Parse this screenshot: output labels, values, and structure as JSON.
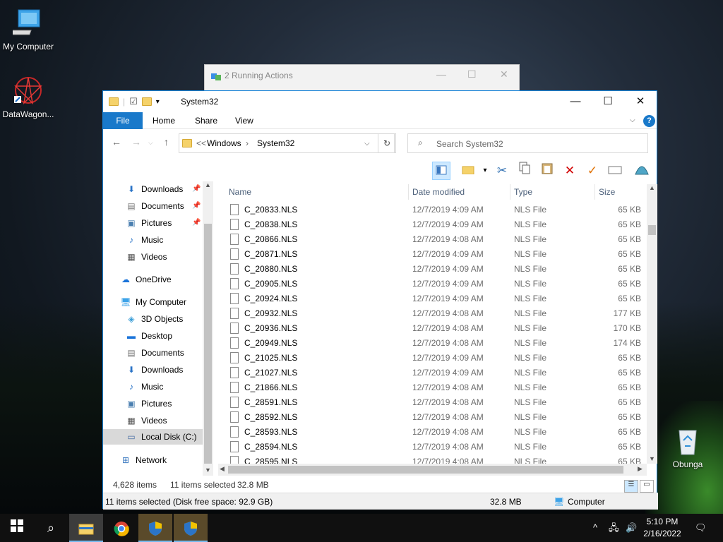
{
  "desktop": {
    "icons": [
      {
        "label": "My Computer"
      },
      {
        "label": "DataWagon..."
      },
      {
        "label": "Obunga"
      }
    ]
  },
  "back_dialog": {
    "title": "2 Running Actions"
  },
  "window": {
    "title": "System32",
    "tabs": [
      "File",
      "Home",
      "Share",
      "View"
    ],
    "address": {
      "prefix": "<<",
      "parts": [
        "Windows",
        "System32"
      ],
      "separator": "›"
    },
    "search_placeholder": "Search System32",
    "nav": [
      {
        "label": "Downloads",
        "icon": "download-icon",
        "pinned": true
      },
      {
        "label": "Documents",
        "icon": "documents-icon",
        "pinned": true
      },
      {
        "label": "Pictures",
        "icon": "pictures-icon",
        "pinned": true
      },
      {
        "label": "Music",
        "icon": "music-icon",
        "pinned": false
      },
      {
        "label": "Videos",
        "icon": "videos-icon",
        "pinned": false
      },
      {
        "label": "OneDrive",
        "icon": "onedrive-icon",
        "pinned": false
      },
      {
        "label": "My Computer",
        "icon": "computer-icon",
        "pinned": false
      },
      {
        "label": "3D Objects",
        "icon": "3d-objects-icon",
        "pinned": false
      },
      {
        "label": "Desktop",
        "icon": "desktop-icon",
        "pinned": false
      },
      {
        "label": "Documents",
        "icon": "documents-icon",
        "pinned": false
      },
      {
        "label": "Downloads",
        "icon": "download-icon",
        "pinned": false
      },
      {
        "label": "Music",
        "icon": "music-icon",
        "pinned": false
      },
      {
        "label": "Pictures",
        "icon": "pictures-icon",
        "pinned": false
      },
      {
        "label": "Videos",
        "icon": "videos-icon",
        "pinned": false
      },
      {
        "label": "Local Disk (C:)",
        "icon": "disk-icon",
        "pinned": false,
        "selected": true
      },
      {
        "label": "Network",
        "icon": "network-icon",
        "pinned": false
      }
    ],
    "columns": [
      "Name",
      "Date modified",
      "Type",
      "Size"
    ],
    "files": [
      {
        "name": "C_20833.NLS",
        "date": "12/7/2019 4:09 AM",
        "type": "NLS File",
        "size": "65 KB"
      },
      {
        "name": "C_20838.NLS",
        "date": "12/7/2019 4:09 AM",
        "type": "NLS File",
        "size": "65 KB"
      },
      {
        "name": "C_20866.NLS",
        "date": "12/7/2019 4:08 AM",
        "type": "NLS File",
        "size": "65 KB"
      },
      {
        "name": "C_20871.NLS",
        "date": "12/7/2019 4:09 AM",
        "type": "NLS File",
        "size": "65 KB"
      },
      {
        "name": "C_20880.NLS",
        "date": "12/7/2019 4:09 AM",
        "type": "NLS File",
        "size": "65 KB"
      },
      {
        "name": "C_20905.NLS",
        "date": "12/7/2019 4:09 AM",
        "type": "NLS File",
        "size": "65 KB"
      },
      {
        "name": "C_20924.NLS",
        "date": "12/7/2019 4:09 AM",
        "type": "NLS File",
        "size": "65 KB"
      },
      {
        "name": "C_20932.NLS",
        "date": "12/7/2019 4:08 AM",
        "type": "NLS File",
        "size": "177 KB"
      },
      {
        "name": "C_20936.NLS",
        "date": "12/7/2019 4:08 AM",
        "type": "NLS File",
        "size": "170 KB"
      },
      {
        "name": "C_20949.NLS",
        "date": "12/7/2019 4:08 AM",
        "type": "NLS File",
        "size": "174 KB"
      },
      {
        "name": "C_21025.NLS",
        "date": "12/7/2019 4:09 AM",
        "type": "NLS File",
        "size": "65 KB"
      },
      {
        "name": "C_21027.NLS",
        "date": "12/7/2019 4:09 AM",
        "type": "NLS File",
        "size": "65 KB"
      },
      {
        "name": "C_21866.NLS",
        "date": "12/7/2019 4:08 AM",
        "type": "NLS File",
        "size": "65 KB"
      },
      {
        "name": "C_28591.NLS",
        "date": "12/7/2019 4:08 AM",
        "type": "NLS File",
        "size": "65 KB"
      },
      {
        "name": "C_28592.NLS",
        "date": "12/7/2019 4:08 AM",
        "type": "NLS File",
        "size": "65 KB"
      },
      {
        "name": "C_28593.NLS",
        "date": "12/7/2019 4:08 AM",
        "type": "NLS File",
        "size": "65 KB"
      },
      {
        "name": "C_28594.NLS",
        "date": "12/7/2019 4:08 AM",
        "type": "NLS File",
        "size": "65 KB"
      },
      {
        "name": "C_28595.NLS",
        "date": "12/7/2019 4:08 AM",
        "type": "NLS File",
        "size": "65 KB"
      }
    ],
    "status": {
      "items": "4,628 items",
      "selected": "11 items selected",
      "size": "32.8 MB"
    },
    "details": {
      "text": "11 items selected (Disk free space: 92.9 GB)",
      "size": "32.8 MB",
      "location": "Computer"
    }
  },
  "taskbar": {
    "time": "5:10 PM",
    "date": "2/16/2022",
    "accent_color": "#1979ca"
  }
}
